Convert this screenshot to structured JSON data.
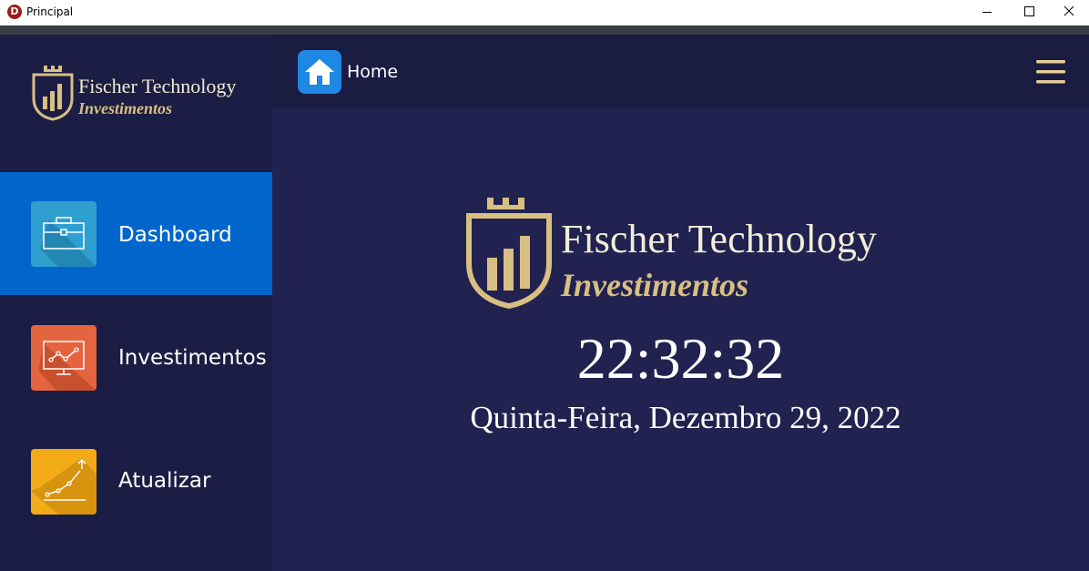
{
  "window": {
    "title": "Principal",
    "app_icon_letter": "D"
  },
  "sidebar": {
    "logo": {
      "line1": "Fischer Technology",
      "line2": "Investimentos"
    },
    "items": [
      {
        "label": "Dashboard",
        "icon": "briefcase-icon",
        "color": "#2e9fcf",
        "active": true
      },
      {
        "label": "Investimentos",
        "icon": "presentation-chart-icon",
        "color": "#e3643f",
        "active": false
      },
      {
        "label": "Atualizar",
        "icon": "growth-chart-icon",
        "color": "#f3ab18",
        "active": false
      }
    ]
  },
  "topbar": {
    "title": "Home",
    "home_icon": "home-icon",
    "menu_icon": "hamburger-menu-icon"
  },
  "main": {
    "logo": {
      "line1": "Fischer Technology",
      "line2": "Investimentos"
    },
    "time": "22:32:32",
    "date": "Quinta-Feira, Dezembro 29, 2022"
  },
  "colors": {
    "sidebar_bg": "#1c1d44",
    "main_bg": "#222250",
    "active_item": "#0066cc",
    "gold": "#d8bf82"
  }
}
